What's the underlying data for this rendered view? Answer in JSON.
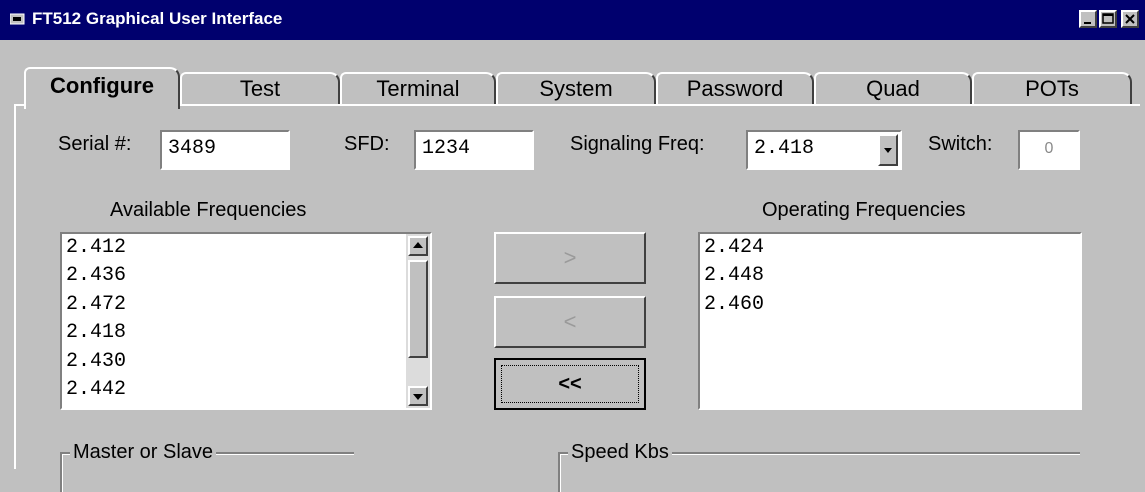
{
  "window": {
    "title": "FT512 Graphical User Interface",
    "icon": "app-icon",
    "controls": [
      "minimize-icon",
      "maximize-icon",
      "close-icon"
    ]
  },
  "tabs": [
    {
      "label": "Configure",
      "active": true
    },
    {
      "label": "Test",
      "active": false
    },
    {
      "label": "Terminal",
      "active": false
    },
    {
      "label": "System",
      "active": false
    },
    {
      "label": "Password",
      "active": false
    },
    {
      "label": "Quad",
      "active": false
    },
    {
      "label": "POTs",
      "active": false
    }
  ],
  "fields": {
    "serial": {
      "label": "Serial #:",
      "value": "3489"
    },
    "sfd": {
      "label": "SFD:",
      "value": "1234"
    },
    "signaling_freq": {
      "label": "Signaling Freq:",
      "value": "2.418"
    },
    "switch": {
      "label": "Switch:",
      "value": "0"
    }
  },
  "available": {
    "label": "Available Frequencies",
    "items": [
      "2.412",
      "2.436",
      "2.472",
      "2.418",
      "2.430",
      "2.442"
    ]
  },
  "operating": {
    "label": "Operating Frequencies",
    "items": [
      "2.424",
      "2.448",
      "2.460"
    ]
  },
  "buttons": {
    "add": ">",
    "remove": "<",
    "remove_all": "<<"
  },
  "groups": {
    "master_slave": "Master or Slave",
    "speed": "Speed Kbs"
  },
  "colors": {
    "titlebar": "#00006e",
    "face": "#c0c0c0"
  }
}
